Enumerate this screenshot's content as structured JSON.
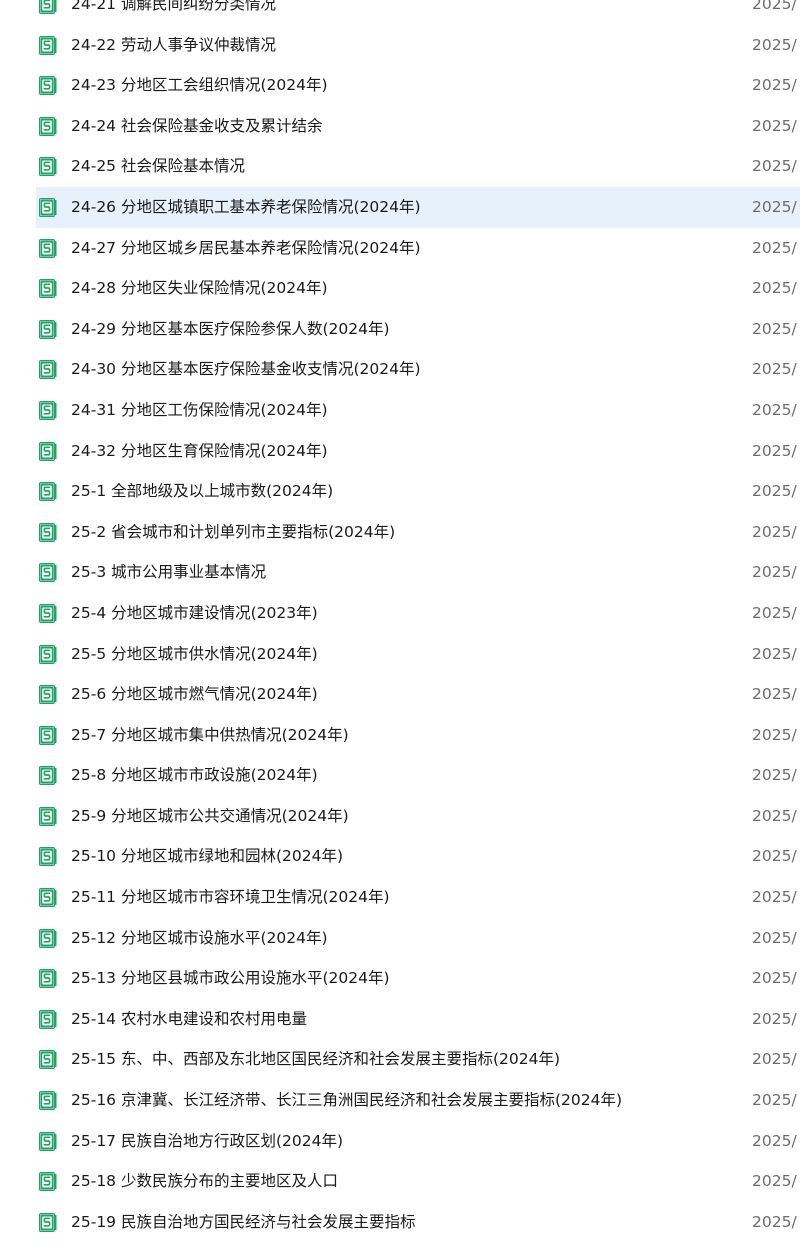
{
  "file_list": {
    "icon": "spreadsheet-file-icon",
    "icon_color": "#21a366",
    "selected_color": "#e6f1fb",
    "rows": [
      {
        "name": "24-21 调解民间纠纷分类情况",
        "date": "2025/"
      },
      {
        "name": "24-22 劳动人事争议仲裁情况",
        "date": "2025/"
      },
      {
        "name": "24-23 分地区工会组织情况(2024年)",
        "date": "2025/"
      },
      {
        "name": "24-24 社会保险基金收支及累计结余",
        "date": "2025/"
      },
      {
        "name": "24-25 社会保险基本情况",
        "date": "2025/"
      },
      {
        "name": "24-26 分地区城镇职工基本养老保险情况(2024年)",
        "date": "2025/",
        "selected": true
      },
      {
        "name": "24-27 分地区城乡居民基本养老保险情况(2024年)",
        "date": "2025/"
      },
      {
        "name": "24-28 分地区失业保险情况(2024年)",
        "date": "2025/"
      },
      {
        "name": "24-29 分地区基本医疗保险参保人数(2024年)",
        "date": "2025/"
      },
      {
        "name": "24-30 分地区基本医疗保险基金收支情况(2024年)",
        "date": "2025/"
      },
      {
        "name": "24-31 分地区工伤保险情况(2024年)",
        "date": "2025/"
      },
      {
        "name": "24-32 分地区生育保险情况(2024年)",
        "date": "2025/"
      },
      {
        "name": "25-1 全部地级及以上城市数(2024年)",
        "date": "2025/"
      },
      {
        "name": "25-2 省会城市和计划单列市主要指标(2024年)",
        "date": "2025/"
      },
      {
        "name": "25-3 城市公用事业基本情况",
        "date": "2025/"
      },
      {
        "name": "25-4 分地区城市建设情况(2023年)",
        "date": "2025/"
      },
      {
        "name": "25-5 分地区城市供水情况(2024年)",
        "date": "2025/"
      },
      {
        "name": "25-6 分地区城市燃气情况(2024年)",
        "date": "2025/"
      },
      {
        "name": "25-7 分地区城市集中供热情况(2024年)",
        "date": "2025/"
      },
      {
        "name": "25-8 分地区城市市政设施(2024年)",
        "date": "2025/"
      },
      {
        "name": "25-9 分地区城市公共交通情况(2024年)",
        "date": "2025/"
      },
      {
        "name": "25-10 分地区城市绿地和园林(2024年)",
        "date": "2025/"
      },
      {
        "name": "25-11 分地区城市市容环境卫生情况(2024年)",
        "date": "2025/"
      },
      {
        "name": "25-12 分地区城市设施水平(2024年)",
        "date": "2025/"
      },
      {
        "name": "25-13 分地区县城市政公用设施水平(2024年)",
        "date": "2025/"
      },
      {
        "name": "25-14 农村水电建设和农村用电量",
        "date": "2025/"
      },
      {
        "name": "25-15 东、中、西部及东北地区国民经济和社会发展主要指标(2024年)",
        "date": "2025/"
      },
      {
        "name": "25-16 京津冀、长江经济带、长江三角洲国民经济和社会发展主要指标(2024年)",
        "date": "2025/"
      },
      {
        "name": "25-17 民族自治地方行政区划(2024年)",
        "date": "2025/"
      },
      {
        "name": "25-18 少数民族分布的主要地区及人口",
        "date": "2025/"
      },
      {
        "name": "25-19 民族自治地方国民经济与社会发展主要指标",
        "date": "2025/"
      }
    ]
  }
}
